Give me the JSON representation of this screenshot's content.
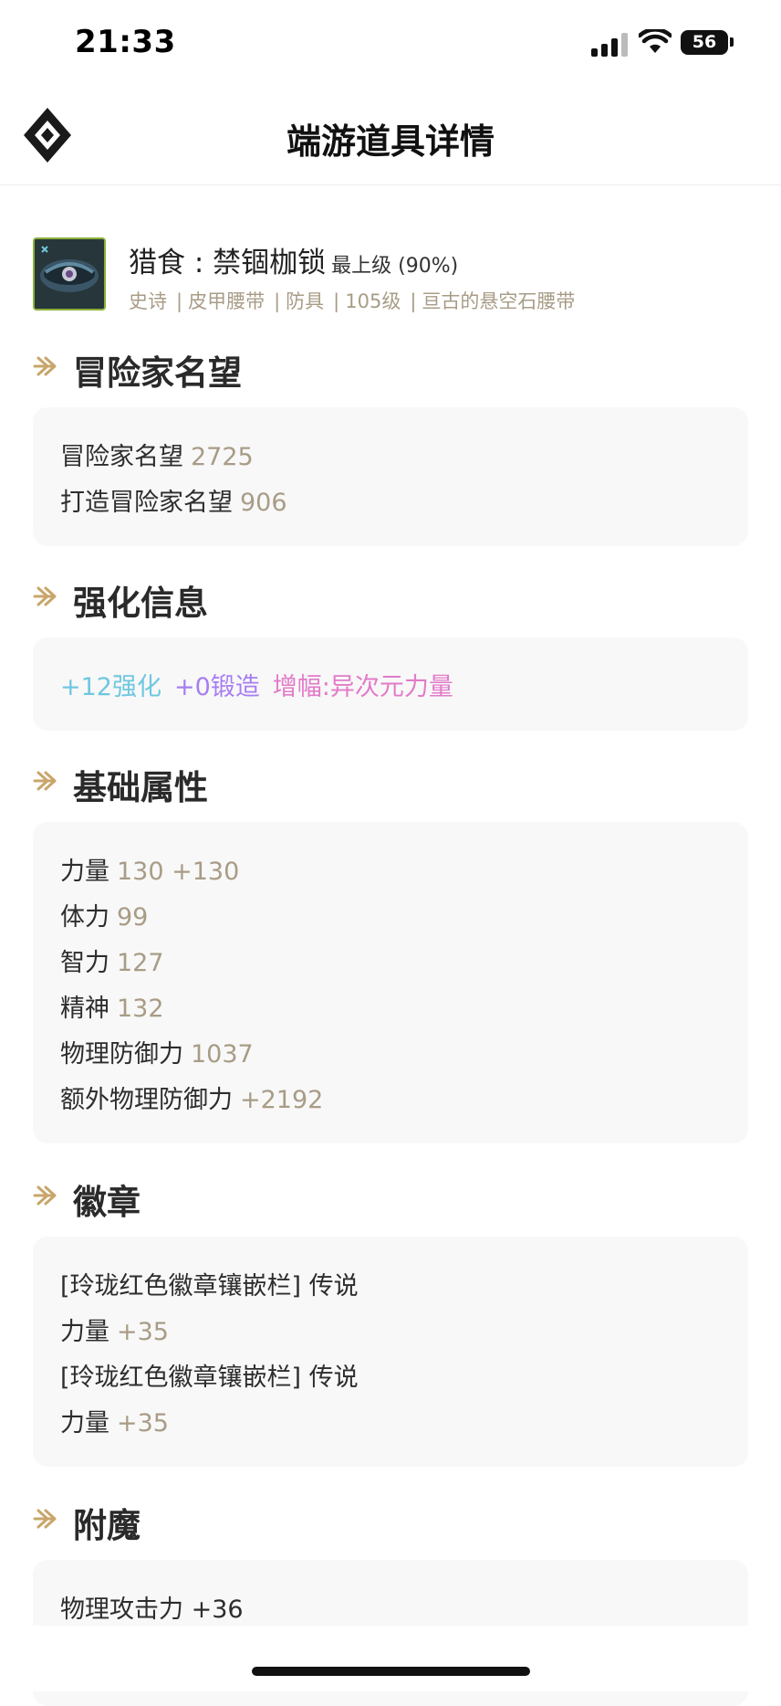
{
  "status_bar": {
    "time": "21:33",
    "battery": "56"
  },
  "header": {
    "title": "端游道具详情",
    "logo_icon": "diamond-logo-icon"
  },
  "item": {
    "name": "猎食 : 禁锢枷锁",
    "grade": "最上级 (90%)",
    "tags": [
      "史诗",
      "皮甲腰带",
      "防具",
      "105级",
      "亘古的悬空石腰带"
    ]
  },
  "sections": {
    "reputation": {
      "title": "冒险家名望",
      "rows": [
        {
          "label": "冒险家名望",
          "value": "2725"
        },
        {
          "label": "打造冒险家名望",
          "value": "906"
        }
      ]
    },
    "enhance": {
      "title": "强化信息",
      "reinforce": "+12强化",
      "forge": "+0锻造",
      "amplify_label": "增幅:",
      "amplify_value": "异次元力量"
    },
    "base_stats": {
      "title": "基础属性",
      "rows": [
        {
          "label": "力量",
          "value": "130 +130"
        },
        {
          "label": "体力",
          "value": "99"
        },
        {
          "label": "智力",
          "value": "127"
        },
        {
          "label": "精神",
          "value": "132"
        },
        {
          "label": "物理防御力",
          "value": "1037"
        },
        {
          "label": "额外物理防御力",
          "value": "+2192"
        }
      ]
    },
    "emblem": {
      "title": "徽章",
      "rows": [
        {
          "label": "[玲珑红色徽章镶嵌栏] 传说",
          "value": ""
        },
        {
          "label": "力量",
          "value": "+35"
        },
        {
          "label": "[玲珑红色徽章镶嵌栏] 传说",
          "value": ""
        },
        {
          "label": "力量",
          "value": "+35"
        }
      ]
    },
    "enchant": {
      "title": "附魔",
      "rows": [
        {
          "label": "物理攻击力 +36",
          "value": ""
        }
      ]
    }
  },
  "colors": {
    "accent_gold": "#c9a56a",
    "value_text": "#a89c86",
    "reinforce": "#6fc7e0",
    "forge": "#a77ef2",
    "amplify": "#e27bc9"
  }
}
